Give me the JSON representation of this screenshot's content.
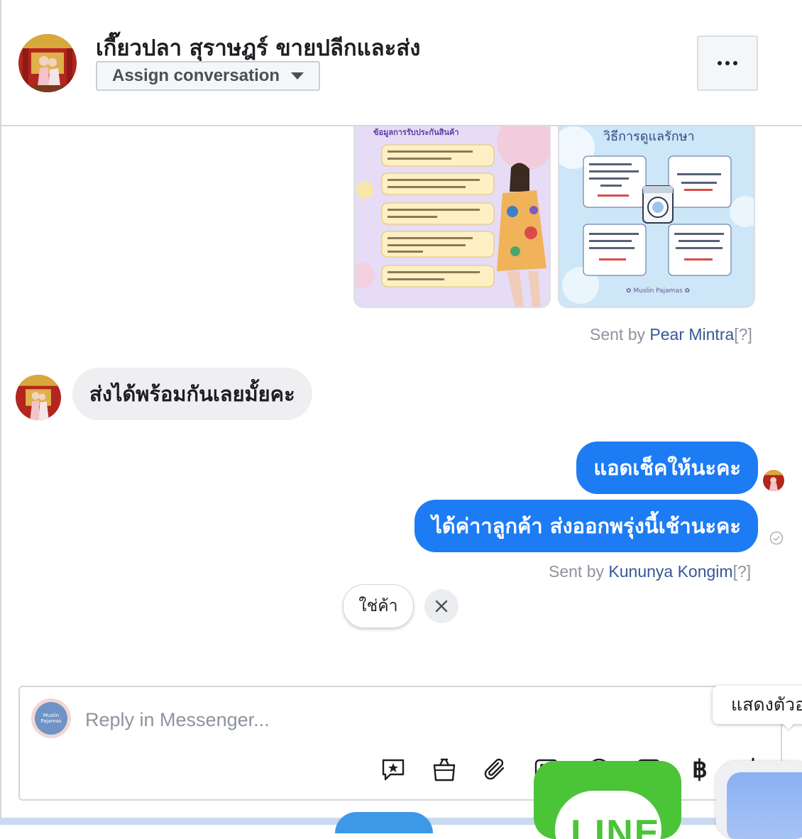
{
  "header": {
    "contact_name": "เกี๊ยวปลา สุราษฎร์ ขายปลีกและส่ง",
    "assign_label": "Assign conversation",
    "more_icon": "more-horizontal-icon"
  },
  "messages": {
    "images_sent_by": {
      "prefix": "Sent by ",
      "name": "Pear Mintra",
      "suffix": "[?]"
    },
    "incoming": {
      "text": "ส่งได้พร้อมกันเลยมั้ยคะ"
    },
    "outgoing": [
      {
        "text": "แอดเช็คให้นะคะ"
      },
      {
        "text": "ได้ค่าาลูกค้า ส่งออกพรุ่งนี้เช้านะคะ"
      }
    ],
    "outgoing_sent_by": {
      "prefix": "Sent by ",
      "name": "Kununya Kongim",
      "suffix": "[?]"
    }
  },
  "image_cards": {
    "left_title": "ข้อมูลการรับประกันสินค้า",
    "right_title": "วิธีการดูแลรักษา"
  },
  "quick_reply": {
    "label": "ใช่ค้า",
    "close_icon": "close-icon"
  },
  "composer": {
    "placeholder": "Reply in Messenger...",
    "tools": [
      "saved-reply-icon",
      "shopping-bag-icon",
      "attachment-icon",
      "image-icon",
      "emoji-icon",
      "gif-icon",
      "baht-icon",
      "like-icon"
    ],
    "baht_symbol": "฿"
  },
  "tooltip": {
    "text": "แสดงตัวอ"
  },
  "dock": {
    "line_label": "LINE"
  },
  "colors": {
    "accent": "#1d7cf4",
    "link": "#365899",
    "line_green": "#4cc438"
  }
}
